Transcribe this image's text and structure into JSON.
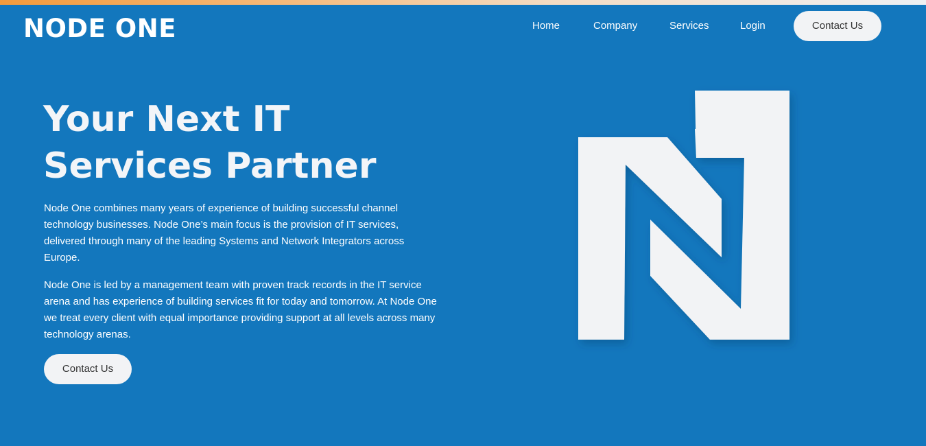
{
  "header": {
    "brand": "NODE ONE",
    "nav": [
      {
        "label": "Home"
      },
      {
        "label": "Company"
      },
      {
        "label": "Services"
      },
      {
        "label": "Login"
      }
    ],
    "contact_label": "Contact Us"
  },
  "hero": {
    "title_line1": "Your Next IT",
    "title_line2": "Services Partner",
    "paragraph1": "Node One combines many years of experience of building successful channel technology businesses. Node One’s main focus is the provision of IT services, delivered through many of the leading Systems and Network Integrators across Europe.",
    "paragraph2": "Node One is led by a management team with proven track records in the IT service arena and has experience of building services fit for today and tomorrow. At Node One we treat every client with equal importance providing support at all levels across many technology arenas.",
    "contact_label": "Contact Us"
  },
  "colors": {
    "background": "#1377bd",
    "accent_strip": "#f39a3c",
    "button_bg": "#f2f3f5",
    "logo_fill": "#f2f3f5"
  },
  "logo": {
    "icon": "n1-logo-icon"
  }
}
